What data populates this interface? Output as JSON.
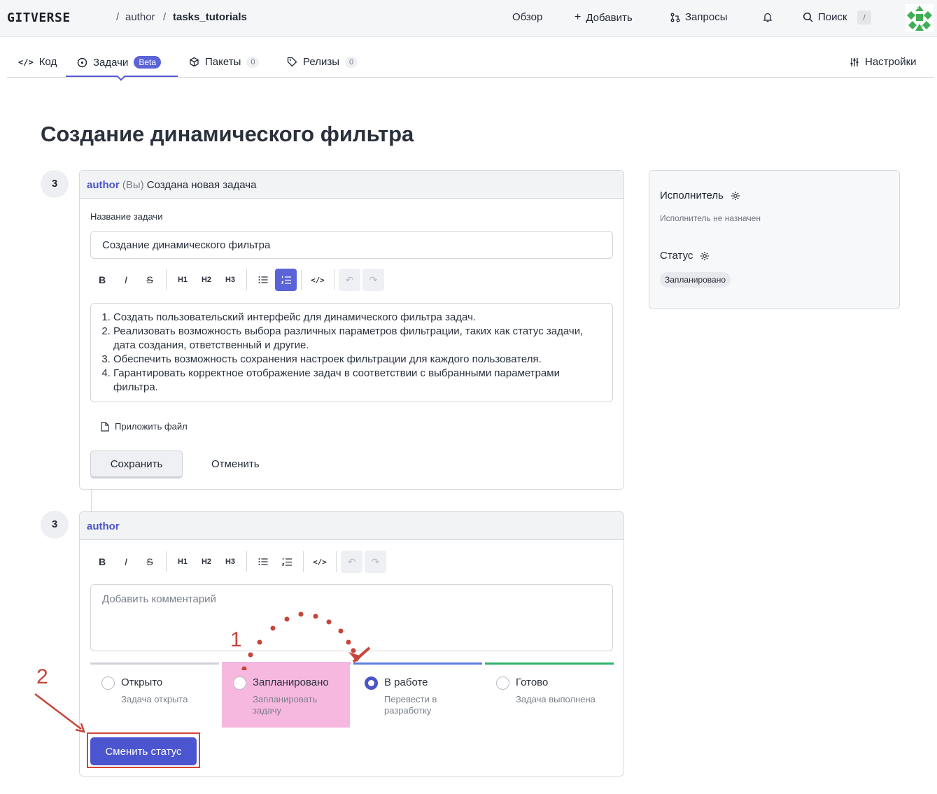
{
  "header": {
    "brand": "GITVERSE",
    "breadcrumb": [
      "author",
      "tasks_tutorials"
    ],
    "nav": {
      "overview": "Обзор",
      "add": "Добавить",
      "requests": "Запросы",
      "search": "Поиск",
      "search_shortcut": "/"
    }
  },
  "tabs": [
    {
      "label": "Код"
    },
    {
      "label": "Задачи",
      "badge": "Beta"
    },
    {
      "label": "Пакеты",
      "count": "0"
    },
    {
      "label": "Релизы",
      "count": "0"
    }
  ],
  "settings_label": "Настройки",
  "page_title": "Создание динамического фильтра",
  "edit_card": {
    "step": "3",
    "author": "author",
    "you": "(Вы)",
    "action": "Создана новая задача",
    "title_label": "Название задачи",
    "title_value": "Создание динамического фильтра",
    "toolbar": {
      "bold": "B",
      "italic": "I",
      "strike": "S",
      "h1": "H1",
      "h2": "H2",
      "h3": "H3"
    },
    "description_items": [
      "Создать пользовательский интерфейс для динамического фильтра задач.",
      "Реализовать возможность выбора различных параметров фильтрации, таких как статус задачи, дата создания, ответственный и другие.",
      "Обеспечить возможность сохранения настроек фильтрации для каждого пользователя.",
      "Гарантировать корректное отображение задач в соответствии с выбранными параметрами фильтра."
    ],
    "attach_label": "Приложить файл",
    "save_label": "Сохранить",
    "cancel_label": "Отменить"
  },
  "comment_card": {
    "step": "3",
    "author": "author",
    "comment_placeholder": "Добавить комментарий",
    "statuses": [
      {
        "label": "Открыто",
        "desc": "Задача открыта",
        "color": "#d0d4da",
        "selected": false
      },
      {
        "label": "Запланировано",
        "desc": "Запланировать задачу",
        "color": "#d97dc9",
        "selected": false,
        "highlight": "#f7b8e0"
      },
      {
        "label": "В работе",
        "desc": "Перевести в разработку",
        "color": "#5b7fe0",
        "selected": true
      },
      {
        "label": "Готово",
        "desc": "Задача выполнена",
        "color": "#2fb36b",
        "selected": false
      }
    ],
    "change_status_label": "Сменить статус"
  },
  "sidebar": {
    "assignee_label": "Исполнитель",
    "assignee_value": "Исполнитель не назначен",
    "status_label": "Статус",
    "status_value": "Запланировано"
  },
  "annotations": {
    "one": "1",
    "two": "2",
    "color": "#c8443a"
  }
}
